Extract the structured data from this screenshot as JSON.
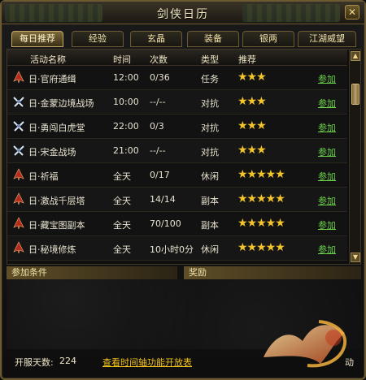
{
  "window": {
    "title": "剑侠日历",
    "close_icon": "✕"
  },
  "tabs": [
    {
      "label": "每日推荐",
      "active": true
    },
    {
      "label": "经验",
      "active": false
    },
    {
      "label": "玄晶",
      "active": false
    },
    {
      "label": "装备",
      "active": false
    },
    {
      "label": "银两",
      "active": false
    },
    {
      "label": "江湖威望",
      "active": false
    }
  ],
  "table": {
    "headers": [
      "活动名称",
      "时间",
      "次数",
      "类型",
      "推荐"
    ],
    "rows": [
      {
        "icon": "red-figure-icon",
        "name": "日·官府通缉",
        "time": "12:00",
        "count": "0/36",
        "type": "任务",
        "stars": "★★★",
        "action": "参加"
      },
      {
        "icon": "crossed-weapons-icon",
        "name": "日·金蒙边境战场",
        "time": "10:00",
        "count": "--/--",
        "type": "对抗",
        "stars": "★★★",
        "action": "参加"
      },
      {
        "icon": "crossed-weapons-icon",
        "name": "日·勇闯白虎堂",
        "time": "22:00",
        "count": "0/3",
        "type": "对抗",
        "stars": "★★★",
        "action": "参加"
      },
      {
        "icon": "crossed-weapons-icon",
        "name": "日·宋金战场",
        "time": "21:00",
        "count": "--/--",
        "type": "对抗",
        "stars": "★★★",
        "action": "参加"
      },
      {
        "icon": "red-figure-icon",
        "name": "日·祈福",
        "time": "全天",
        "count": "0/17",
        "type": "休闲",
        "stars": "★★★★★",
        "action": "参加"
      },
      {
        "icon": "red-figure-icon",
        "name": "日·激战千层塔",
        "time": "全天",
        "count": "14/14",
        "type": "副本",
        "stars": "★★★★★",
        "action": "参加"
      },
      {
        "icon": "red-figure-icon",
        "name": "日·藏宝图副本",
        "time": "全天",
        "count": "70/100",
        "type": "副本",
        "stars": "★★★★★",
        "action": "参加"
      },
      {
        "icon": "red-figure-icon",
        "name": "日·秘境修炼",
        "time": "全天",
        "count": "10小时0分",
        "type": "休闲",
        "stars": "★★★★★",
        "action": "参加"
      }
    ]
  },
  "sections": {
    "conditions": "参加条件",
    "rewards": "奖励"
  },
  "footer": {
    "days_label": "开服天数:",
    "days_value": "224",
    "schedule_link": "查看时间轴功能开放表",
    "extra": "动"
  },
  "colors": {
    "accent": "#f2c21a",
    "link": "#6bd24a",
    "star": "#f4c52a",
    "border": "#6b5a32"
  }
}
